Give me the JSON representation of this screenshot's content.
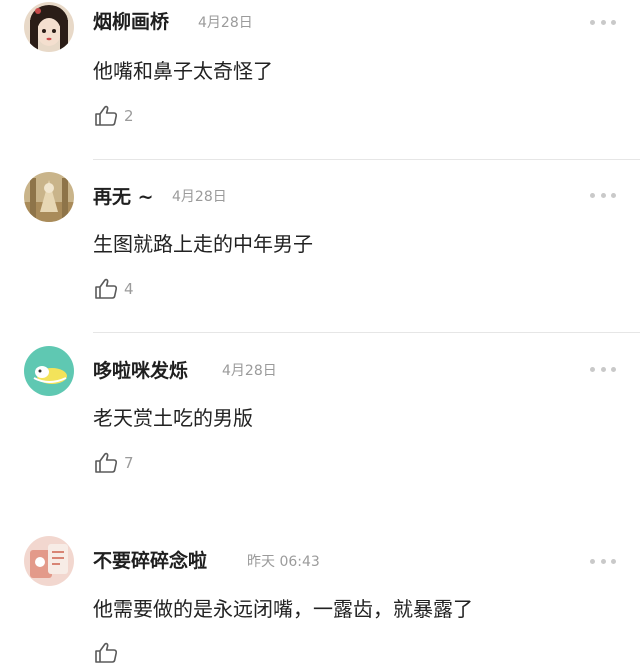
{
  "comments": [
    {
      "username": "烟柳画桥",
      "time": "4月28日",
      "content": "他嘴和鼻子太奇怪了",
      "likes": "2"
    },
    {
      "username": "再无 ~",
      "time": "4月28日",
      "content": "生图就路上走的中年男子",
      "likes": "4"
    },
    {
      "username": "哆啦咪发烁",
      "time": "4月28日",
      "content": "老天赏土吃的男版",
      "likes": "7"
    },
    {
      "username": "不要碎碎念啦",
      "time": "昨天 06:43",
      "content": "他需要做的是永远闭嘴，一露齿，就暴露了",
      "likes": ""
    }
  ],
  "icons": {
    "like": "thumbs-up-icon",
    "more": "more-dots-icon"
  },
  "colors": {
    "username": "#1f1f1f",
    "content": "#222222",
    "meta": "#9b9b9b",
    "divider": "#e6e6e6"
  }
}
